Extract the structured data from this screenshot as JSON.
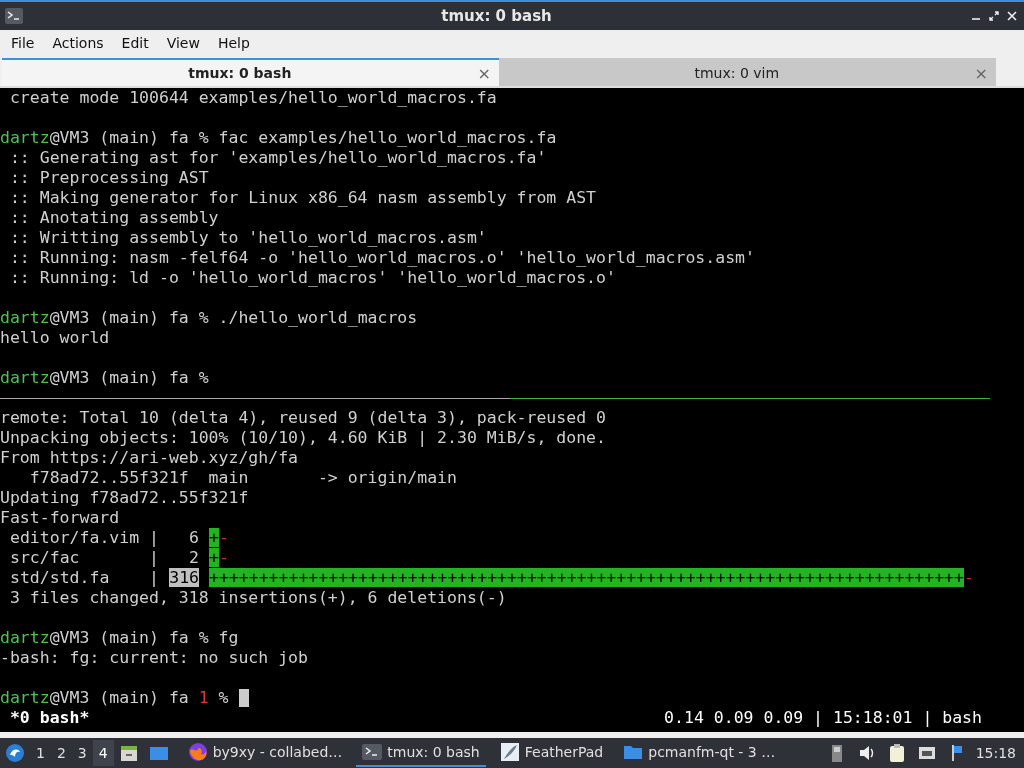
{
  "window": {
    "title": "tmux: 0 bash"
  },
  "menu": [
    "File",
    "Actions",
    "Edit",
    "View",
    "Help"
  ],
  "tabs": [
    {
      "label": "tmux: 0 bash",
      "selected": true,
      "close": "×"
    },
    {
      "label": "tmux: 0 vim",
      "selected": false,
      "close": "×"
    }
  ],
  "top_pane": {
    "lines": [
      {
        "kind": "text",
        "text": " create mode 100644 examples/hello_world_macros.fa"
      },
      {
        "kind": "blank"
      },
      {
        "kind": "prompt",
        "user": "dartz",
        "host": "@VM3 (main) fa ",
        "symbol": "%",
        "command": " fac examples/hello_world_macros.fa",
        "cursor": false
      },
      {
        "kind": "text",
        "text": " :: Generating ast for 'examples/hello_world_macros.fa'"
      },
      {
        "kind": "text",
        "text": " :: Preprocessing AST"
      },
      {
        "kind": "text",
        "text": " :: Making generator for Linux x86_64 nasm assembly from AST"
      },
      {
        "kind": "text",
        "text": " :: Anotating assembly"
      },
      {
        "kind": "text",
        "text": " :: Writting assembly to 'hello_world_macros.asm'"
      },
      {
        "kind": "text",
        "text": " :: Running: nasm -felf64 -o 'hello_world_macros.o' 'hello_world_macros.asm'"
      },
      {
        "kind": "text",
        "text": " :: Running: ld -o 'hello_world_macros' 'hello_world_macros.o'"
      },
      {
        "kind": "blank"
      },
      {
        "kind": "prompt",
        "user": "dartz",
        "host": "@VM3 (main) fa ",
        "symbol": "%",
        "command": " ./hello_world_macros",
        "cursor": false
      },
      {
        "kind": "text",
        "text": "hello world"
      },
      {
        "kind": "blank"
      },
      {
        "kind": "prompt",
        "user": "dartz",
        "host": "@VM3 (main) fa ",
        "symbol": "%",
        "cursor": false
      }
    ]
  },
  "bottom_pane": {
    "lines": [
      {
        "kind": "text",
        "text": "remote: Total 10 (delta 4), reused 9 (delta 3), pack-reused 0"
      },
      {
        "kind": "text",
        "text": "Unpacking objects: 100% (10/10), 4.60 KiB | 2.30 MiB/s, done."
      },
      {
        "kind": "text",
        "text": "From https://ari-web.xyz/gh/fa"
      },
      {
        "kind": "text",
        "text": "   f78ad72..55f321f  main       -> origin/main"
      },
      {
        "kind": "text",
        "text": "Updating f78ad72..55f321f"
      },
      {
        "kind": "text",
        "text": "Fast-forward"
      },
      {
        "kind": "diffstat",
        "file": "editor/fa.vim |",
        "count": "6",
        "plus": "+",
        "minus": "-",
        "highlighted": false
      },
      {
        "kind": "diffstat",
        "file": "src/fac       |",
        "count": "2",
        "plus": "+",
        "minus": "-",
        "highlighted": false
      },
      {
        "kind": "diffstat",
        "file": "std/std.fa    |",
        "count": "316",
        "plus": "++++++++++++++++++++++++++++++++++++++++++++++++++++++++++++++++++++++++++++",
        "minus": "-",
        "highlighted": true
      },
      {
        "kind": "text",
        "text": " 3 files changed, 318 insertions(+), 6 deletions(-)"
      },
      {
        "kind": "blank"
      },
      {
        "kind": "prompt",
        "user": "dartz",
        "host": "@VM3 (main) fa ",
        "symbol": "%",
        "command": " fg",
        "cursor": false
      },
      {
        "kind": "text",
        "text": "-bash: fg: current: no such job"
      },
      {
        "kind": "blank"
      },
      {
        "kind": "prompt",
        "user": "dartz",
        "host": "@VM3 (main) fa ",
        "status": "1 ",
        "symbol": "%",
        "cursor": true
      }
    ]
  },
  "status_bar": {
    "session": " *0 bash*",
    "info": "0.14 0.09 0.09 | 15:18:01 | bash"
  },
  "taskbar": {
    "workspaces": [
      {
        "label": "1",
        "selected": false
      },
      {
        "label": "2",
        "selected": false
      },
      {
        "label": "3",
        "selected": false
      },
      {
        "label": "4",
        "selected": true
      }
    ],
    "windows": [
      {
        "kind": "browser",
        "label": "by9xy - collabed…",
        "selected": false
      },
      {
        "kind": "terminal",
        "label": "tmux: 0 bash",
        "selected": true
      },
      {
        "kind": "editor",
        "label": "FeatherPad",
        "selected": false
      },
      {
        "kind": "folder",
        "label": "pcmanfm-qt - 3 …",
        "selected": false
      }
    ],
    "clock": "15:18"
  }
}
